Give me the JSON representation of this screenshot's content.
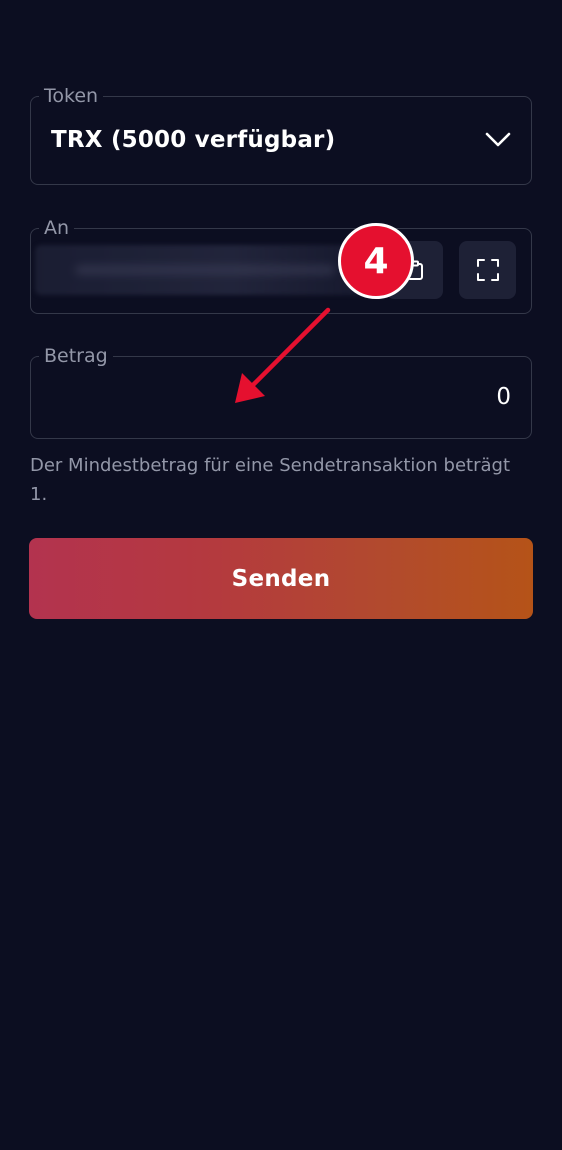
{
  "form": {
    "token": {
      "label": "Token",
      "value": "TRX (5000 verfügbar)",
      "icon": "chevron-down-icon"
    },
    "to": {
      "label": "An",
      "address_value": "",
      "paste_icon": "clipboard-icon",
      "scan_icon": "scan-qr-icon"
    },
    "amount": {
      "label": "Betrag",
      "value": "0"
    },
    "hint": "Der Mindestbetrag für eine Sendetransaktion beträgt 1.",
    "send_label": "Senden"
  },
  "annotation": {
    "step_number": "4",
    "color": "#e5102f"
  },
  "colors": {
    "background": "#0c0e21",
    "border": "#343849",
    "muted_text": "#9397a8",
    "button_gradient_start": "#b3334f",
    "button_gradient_end": "#b55318"
  }
}
